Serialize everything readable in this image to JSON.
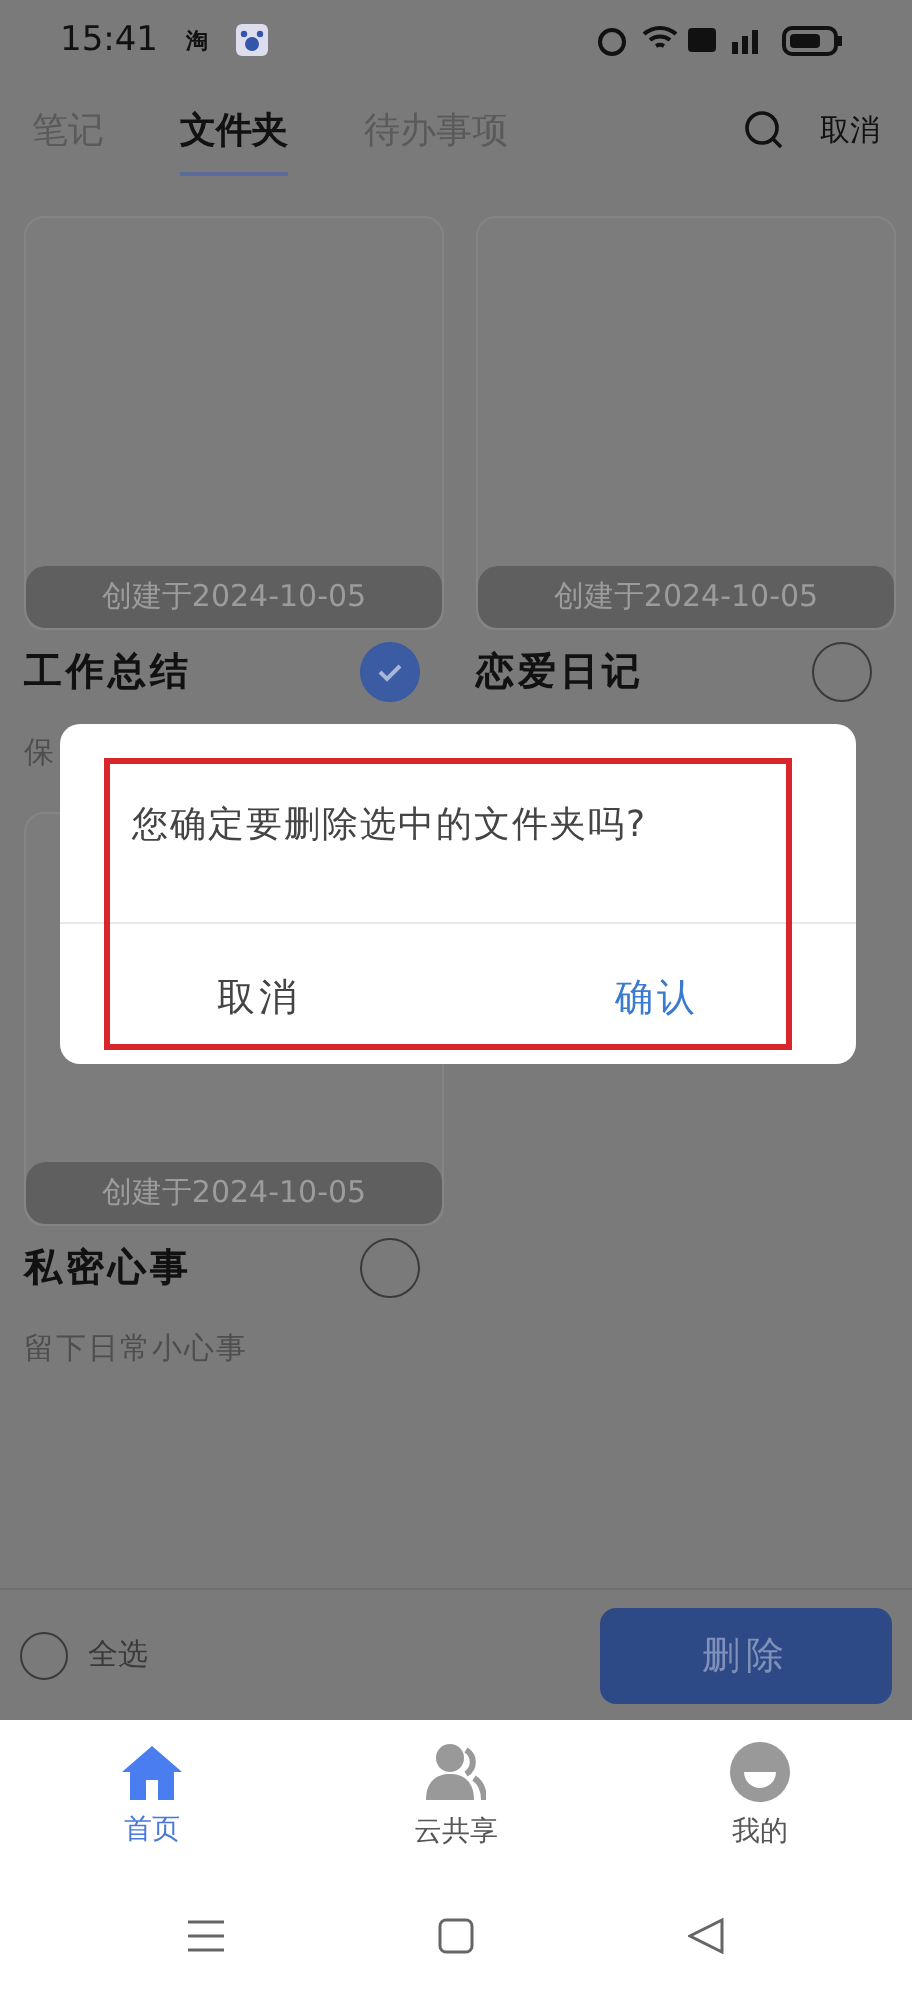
{
  "status_bar": {
    "time": "15:41",
    "app_badge": "淘"
  },
  "tabs": [
    {
      "label": "笔记",
      "selected": false
    },
    {
      "label": "文件夹",
      "selected": true
    },
    {
      "label": "待办事项",
      "selected": false
    }
  ],
  "header_action": "取消",
  "folders": [
    {
      "created": "创建于2024-10-05",
      "title": "工作总结",
      "subtitle": "保",
      "checked": true
    },
    {
      "created": "创建于2024-10-05",
      "title": "恋爱日记",
      "checked": false
    },
    {
      "created": "创建于2024-10-05",
      "title": "私密心事",
      "subtitle": "留下日常小心事",
      "checked": false
    }
  ],
  "action_bar": {
    "select_all": {
      "label": "全选",
      "checked": false
    },
    "delete_button": "删除"
  },
  "dialog": {
    "message": "您确定要删除选中的文件夹吗?",
    "cancel": "取消",
    "confirm": "确认",
    "highlighted": true
  },
  "nav": [
    {
      "label": "首页",
      "kind": "home",
      "selected": true
    },
    {
      "label": "云共享",
      "kind": "people",
      "selected": false
    },
    {
      "label": "我的",
      "kind": "face",
      "selected": false
    }
  ]
}
